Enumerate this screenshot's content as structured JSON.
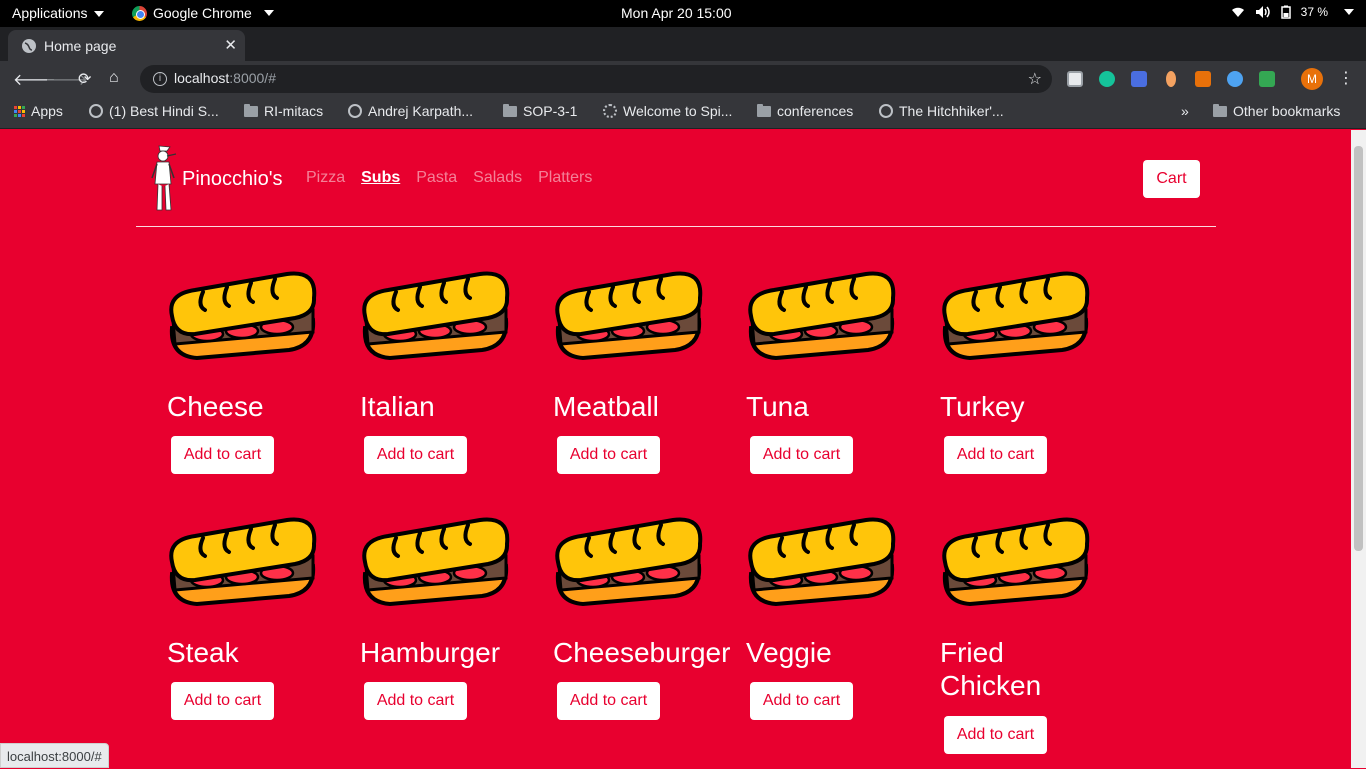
{
  "system_bar": {
    "applications_label": "Applications",
    "app_label": "Google Chrome",
    "clock": "Mon Apr 20  15:00",
    "battery": "37 %"
  },
  "browser": {
    "tab_title": "Home page",
    "url_host": "localhost",
    "url_path": ":8000/#",
    "new_tab_symbol": "+",
    "status_url": "localhost:8000/#"
  },
  "bookmarks": {
    "items": [
      {
        "label": "Apps",
        "icon": "apps-grid-icon"
      },
      {
        "label": "(1) Best Hindi S...",
        "icon": "globe-icon"
      },
      {
        "label": "RI-mitacs",
        "icon": "folder-icon"
      },
      {
        "label": "Andrej Karpath...",
        "icon": "globe-icon"
      },
      {
        "label": "SOP-3-1",
        "icon": "folder-icon"
      },
      {
        "label": "Welcome to Spi...",
        "icon": "spinner-icon"
      },
      {
        "label": "conferences",
        "icon": "folder-icon"
      },
      {
        "label": "The Hitchhiker'...",
        "icon": "globe-icon"
      }
    ],
    "overflow": "»",
    "other": "Other bookmarks"
  },
  "site": {
    "brand": "Pinocchio's",
    "nav": [
      {
        "label": "Pizza",
        "active": false
      },
      {
        "label": "Subs",
        "active": true
      },
      {
        "label": "Pasta",
        "active": false
      },
      {
        "label": "Salads",
        "active": false
      },
      {
        "label": "Platters",
        "active": false
      }
    ],
    "cart_label": "Cart",
    "add_to_cart_label": "Add to cart",
    "products": [
      {
        "name": "Cheese"
      },
      {
        "name": "Italian"
      },
      {
        "name": "Meatball"
      },
      {
        "name": "Tuna"
      },
      {
        "name": "Turkey"
      },
      {
        "name": "Steak"
      },
      {
        "name": "Hamburger"
      },
      {
        "name": "Cheeseburger"
      },
      {
        "name": "Veggie"
      },
      {
        "name": "Fried Chicken"
      }
    ]
  },
  "colors": {
    "page_background": "#e8002f",
    "sub_bread": "#ffc50a",
    "sub_bottom": "#ff9f1a",
    "sub_filling": "#ff3048",
    "sub_meat": "#6b4a3a"
  }
}
